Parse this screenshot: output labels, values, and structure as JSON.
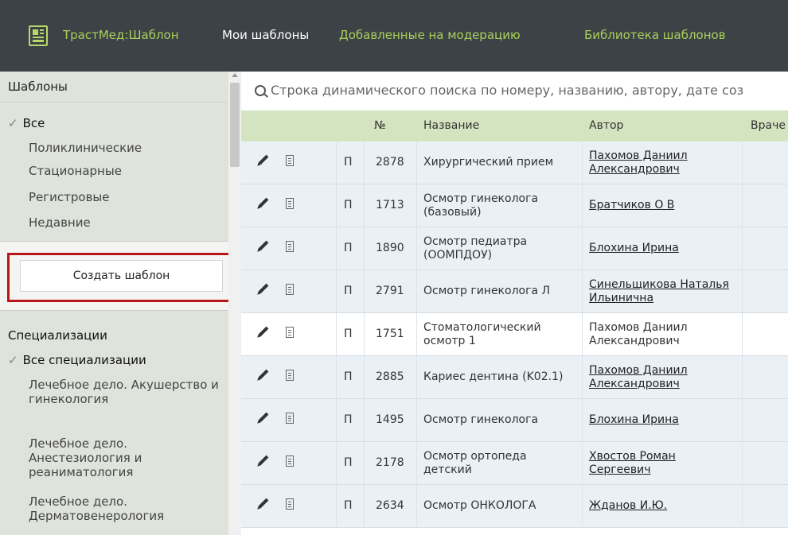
{
  "topbar": {
    "brand": "ТрастМед:Шаблон",
    "nav": [
      "Мои шаблоны",
      "Добавленные на модерацию",
      "Библиотека шаблонов"
    ]
  },
  "sidebar": {
    "templates_title": "Шаблоны",
    "filters": [
      "Все",
      "Поликлинические",
      "Стационарные",
      "Регистровые",
      "Недавние"
    ],
    "create_button": "Создать шаблон",
    "spec_title": "Специализации",
    "specs": [
      "Все специализации",
      "Лечебное дело. Акушерство и гинекология",
      "Лечебное дело. Анестезиология и реаниматология",
      "Лечебное дело. Дерматовенерология"
    ]
  },
  "search": {
    "placeholder": "Строка динамического поиска по номеру, названию, автору, дате соз"
  },
  "table": {
    "headers": {
      "num": "№",
      "name": "Название",
      "author": "Автор",
      "doctors": "Враче"
    },
    "rows": [
      {
        "type": "П",
        "num": "2878",
        "name": "Хирургический прием",
        "author": "Пахомов Даниил Александрович",
        "link": true
      },
      {
        "type": "П",
        "num": "1713",
        "name": "Осмотр гинеколога (базовый)",
        "author": "Братчиков О В",
        "link": true
      },
      {
        "type": "П",
        "num": "1890",
        "name": "Осмотр педиатра (ООМПДОУ)",
        "author": "Блохина Ирина",
        "link": true
      },
      {
        "type": "П",
        "num": "2791",
        "name": "Осмотр гинеколога Л",
        "author": "Синельщикова Наталья Ильинична",
        "link": true
      },
      {
        "type": "П",
        "num": "1751",
        "name": "Стоматологический осмотр 1",
        "author": "Пахомов Даниил Александрович",
        "link": false
      },
      {
        "type": "П",
        "num": "2885",
        "name": "Кариес дентина (K02.1)",
        "author": "Пахомов Даниил Александрович",
        "link": true
      },
      {
        "type": "П",
        "num": "1495",
        "name": "Осмотр гинеколога",
        "author": "Блохина Ирина",
        "link": true
      },
      {
        "type": "П",
        "num": "2178",
        "name": "Осмотр ортопеда детский",
        "author": "Хвостов Роман Сергеевич",
        "link": true
      },
      {
        "type": "П",
        "num": "2634",
        "name": "Осмотр ОНКОЛОГА",
        "author": "Жданов И.Ю.",
        "link": true
      }
    ]
  },
  "colors": {
    "topbar_bg": "#3d4247",
    "brand_green": "#a7d15a",
    "header_green": "#d4e4c1",
    "row_blue": "#e9f0f6",
    "highlight_red": "#b8171a"
  }
}
